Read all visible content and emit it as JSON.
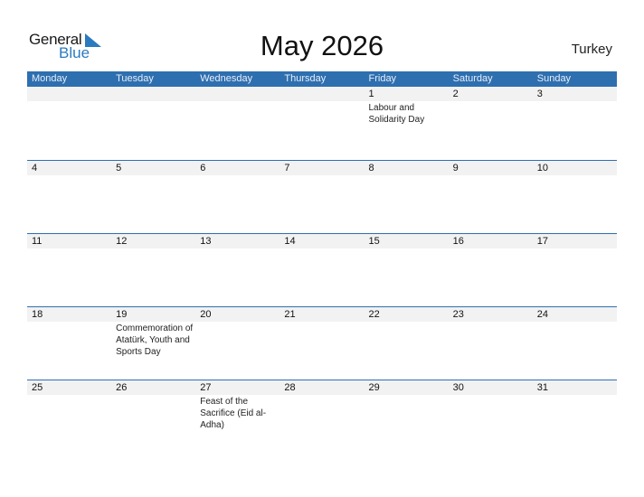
{
  "logo": {
    "general": "General",
    "blue": "Blue"
  },
  "title": "May 2026",
  "country": "Turkey",
  "colors": {
    "header_bg": "#2e6fb0",
    "logo_blue": "#2a7ac0",
    "strip_bg": "#f2f2f2"
  },
  "weekdays": [
    "Monday",
    "Tuesday",
    "Wednesday",
    "Thursday",
    "Friday",
    "Saturday",
    "Sunday"
  ],
  "weeks": [
    [
      {
        "day": "",
        "event": ""
      },
      {
        "day": "",
        "event": ""
      },
      {
        "day": "",
        "event": ""
      },
      {
        "day": "",
        "event": ""
      },
      {
        "day": "1",
        "event": "Labour and Solidarity Day"
      },
      {
        "day": "2",
        "event": ""
      },
      {
        "day": "3",
        "event": ""
      }
    ],
    [
      {
        "day": "4",
        "event": ""
      },
      {
        "day": "5",
        "event": ""
      },
      {
        "day": "6",
        "event": ""
      },
      {
        "day": "7",
        "event": ""
      },
      {
        "day": "8",
        "event": ""
      },
      {
        "day": "9",
        "event": ""
      },
      {
        "day": "10",
        "event": ""
      }
    ],
    [
      {
        "day": "11",
        "event": ""
      },
      {
        "day": "12",
        "event": ""
      },
      {
        "day": "13",
        "event": ""
      },
      {
        "day": "14",
        "event": ""
      },
      {
        "day": "15",
        "event": ""
      },
      {
        "day": "16",
        "event": ""
      },
      {
        "day": "17",
        "event": ""
      }
    ],
    [
      {
        "day": "18",
        "event": ""
      },
      {
        "day": "19",
        "event": "Commemoration of Atatürk, Youth and Sports Day"
      },
      {
        "day": "20",
        "event": ""
      },
      {
        "day": "21",
        "event": ""
      },
      {
        "day": "22",
        "event": ""
      },
      {
        "day": "23",
        "event": ""
      },
      {
        "day": "24",
        "event": ""
      }
    ],
    [
      {
        "day": "25",
        "event": ""
      },
      {
        "day": "26",
        "event": ""
      },
      {
        "day": "27",
        "event": "Feast of the Sacrifice (Eid al-Adha)"
      },
      {
        "day": "28",
        "event": ""
      },
      {
        "day": "29",
        "event": ""
      },
      {
        "day": "30",
        "event": ""
      },
      {
        "day": "31",
        "event": ""
      }
    ]
  ]
}
